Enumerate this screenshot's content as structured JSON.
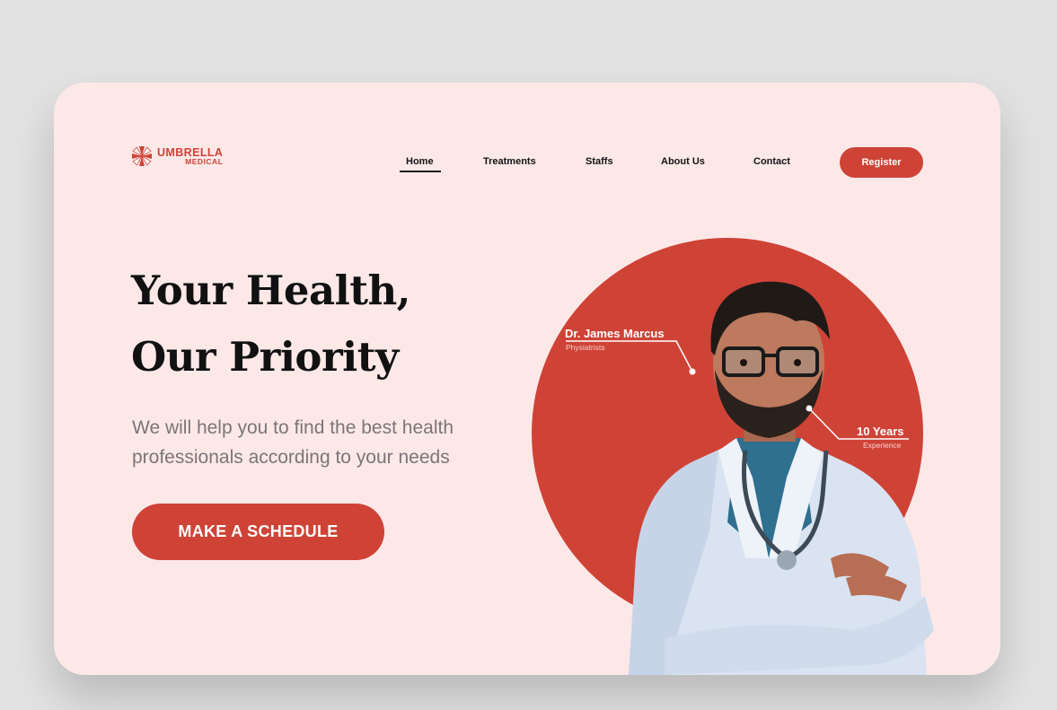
{
  "brand": {
    "name_line1": "UMBRELLA",
    "name_line2": "MEDICAL",
    "logo_icon": "umbrella-logo-icon",
    "accent_color": "#cf4337"
  },
  "nav": {
    "items": [
      {
        "label": "Home",
        "active": true
      },
      {
        "label": "Treatments",
        "active": false
      },
      {
        "label": "Staffs",
        "active": false
      },
      {
        "label": "About Us",
        "active": false
      },
      {
        "label": "Contact",
        "active": false
      }
    ],
    "register_label": "Register"
  },
  "hero": {
    "headline_line1": "Your Health,",
    "headline_line2": "Our Priority",
    "subtext": "We will help you to find the best health professionals according to your needs",
    "cta_label": "MAKE A SCHEDULE"
  },
  "doctor": {
    "name": "Dr. James Marcus",
    "role": "Physiatrists",
    "years": "10 Years",
    "years_caption": "Experience"
  }
}
